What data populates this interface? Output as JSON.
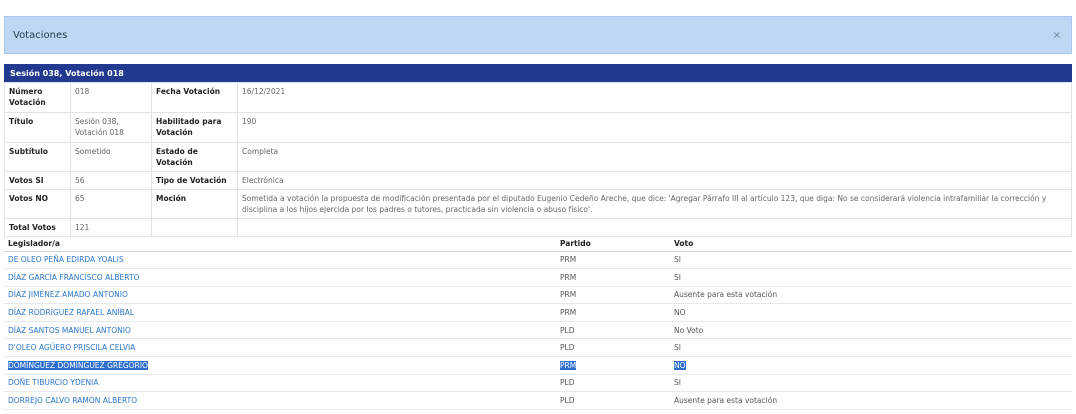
{
  "modal": {
    "title": "Votaciones",
    "close": "×"
  },
  "session_bar": "Sesión 038, Votación 018",
  "details": {
    "numero_label": "Número Votación",
    "numero_value": "018",
    "fecha_label": "Fecha Votación",
    "fecha_value": "16/12/2021",
    "titulo_label": "Título",
    "titulo_value": "Sesión 038, Votación 018",
    "habilitado_label": "Habilitado para Votación",
    "habilitado_value": "190",
    "subtitulo_label": "Subtítulo",
    "subtitulo_value": "Sometido",
    "estado_label": "Estado de Votación",
    "estado_value": "Completa",
    "votos_si_label": "Votos SI",
    "votos_si_value": "56",
    "tipo_label": "Tipo de Votación",
    "tipo_value": "Electrónica",
    "votos_no_label": "Votos NO",
    "votos_no_value": "65",
    "mocion_label": "Moción",
    "mocion_value": "Sometida a votación la propuesta de modificación presentada por el diputado Eugenio Cedeño Areche, que dice: 'Agregar Párrafo III al artículo 123, que diga: No se considerará violencia intrafamiliar la corrección y disciplina a los hijos ejercida por los padres o tutores, practicada sin violencia o abuso físico'.",
    "total_label": "Total Votos",
    "total_value": "121"
  },
  "votes_table": {
    "headers": {
      "legislador": "Legislador/a",
      "partido": "Partido",
      "voto": "Voto"
    },
    "rows": [
      {
        "name": "DE OLEO PEÑA EDIRDA YOALIS",
        "party": "PRM",
        "vote": "SI"
      },
      {
        "name": "DÍAZ GARCÍA FRANCISCO ALBERTO",
        "party": "PRM",
        "vote": "SI"
      },
      {
        "name": "DÍAZ JIMÉNEZ AMADO ANTONIO",
        "party": "PRM",
        "vote": "Ausente para esta votación"
      },
      {
        "name": "DÍAZ RODRÍGUEZ RAFAEL ANÍBAL",
        "party": "PRM",
        "vote": "NO"
      },
      {
        "name": "DÍAZ SANTOS MANUEL ANTONIO",
        "party": "PLD",
        "vote": "No Voto"
      },
      {
        "name": "D'OLEO AGÜERO PRISCILA CELVIA",
        "party": "PLD",
        "vote": "SI"
      },
      {
        "name": "DOMÍNGUEZ DOMÍNGUEZ GREGORIO",
        "party": "PRM",
        "vote": "NO"
      },
      {
        "name": "DOÑE TIBURCIO YDENIA",
        "party": "PLD",
        "vote": "SI"
      },
      {
        "name": "DORREJO CALVO RAMÓN ALBERTO",
        "party": "PLD",
        "vote": "Ausente para esta votación"
      }
    ]
  }
}
